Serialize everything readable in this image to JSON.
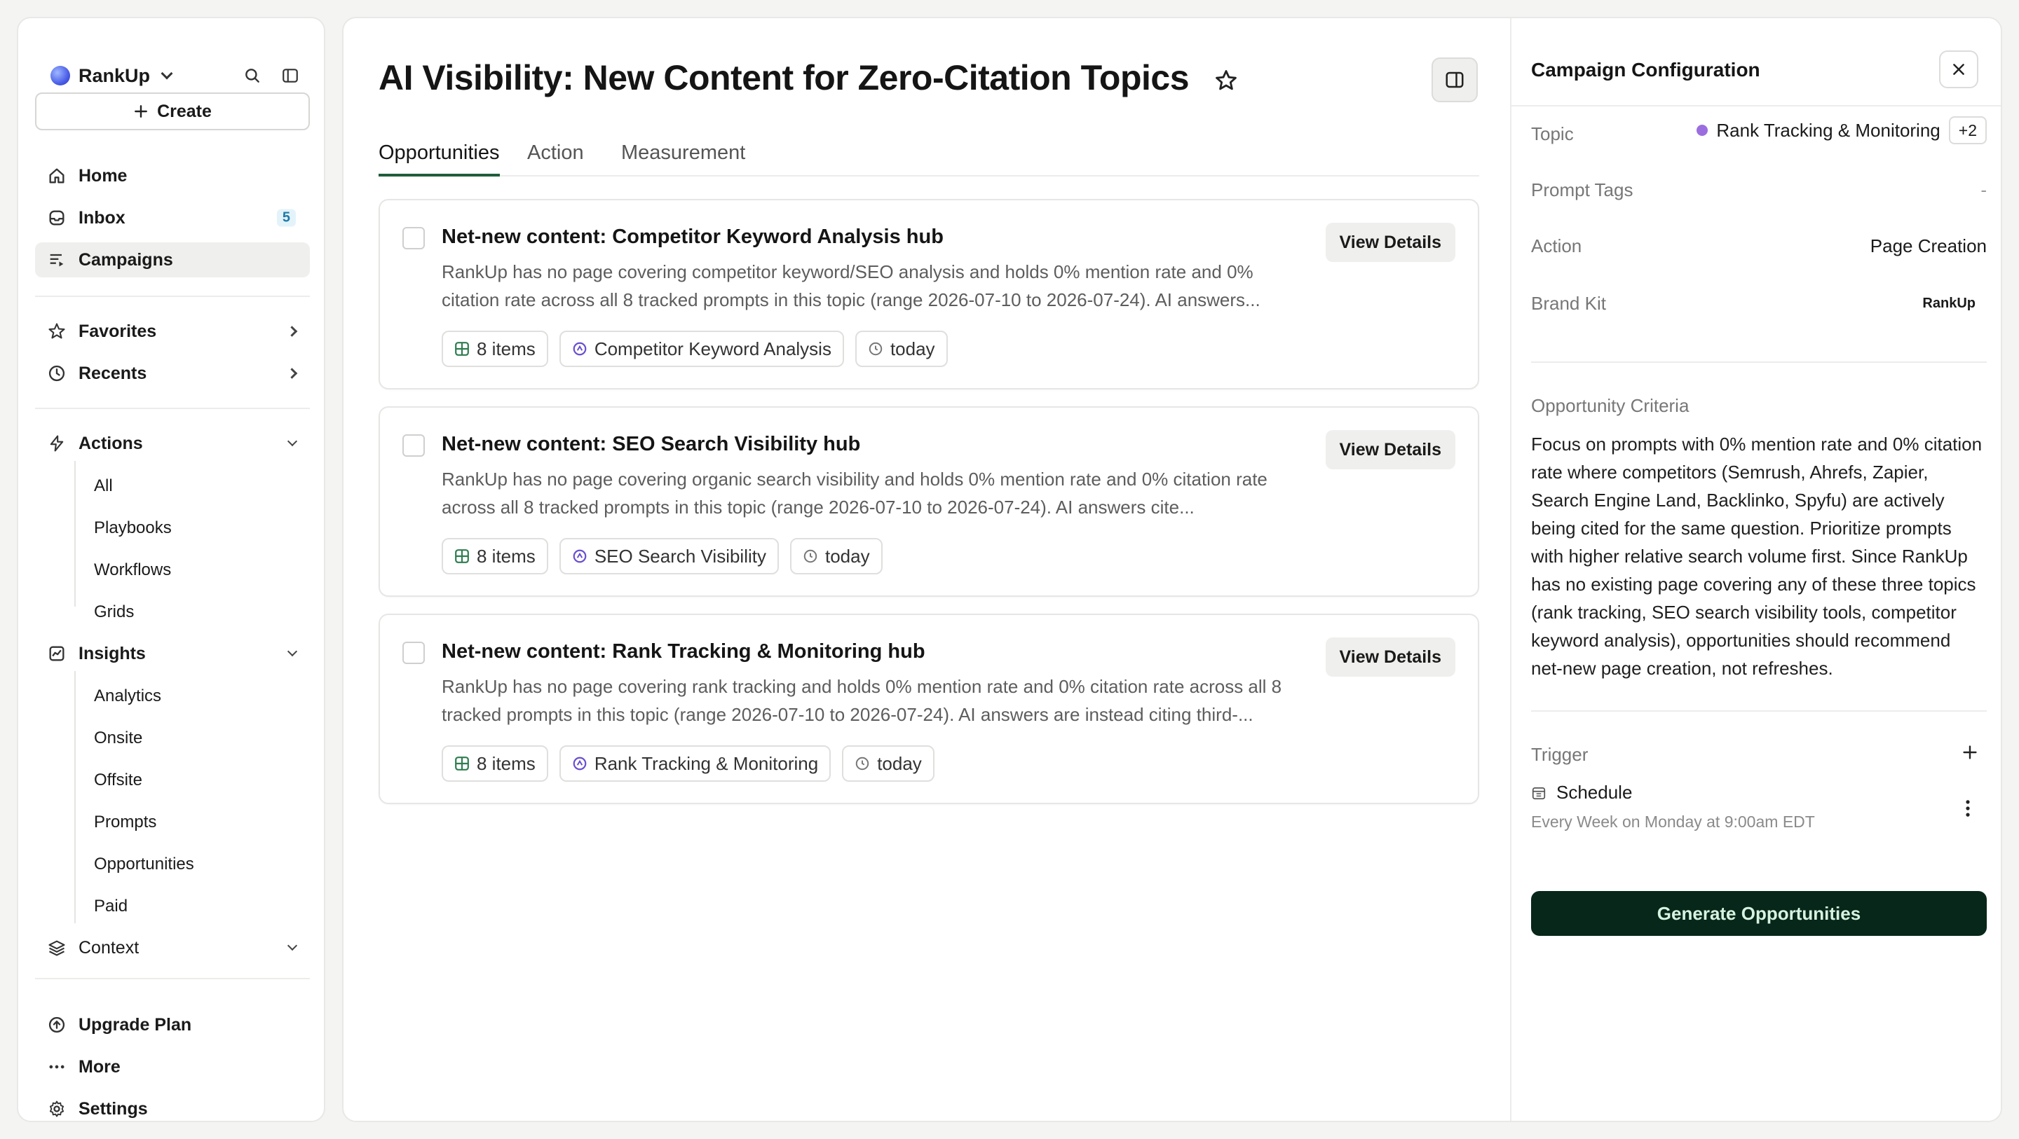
{
  "sidebar": {
    "brand": "RankUp",
    "create_label": "Create",
    "nav": {
      "home": "Home",
      "inbox": "Inbox",
      "inbox_count": "5",
      "campaigns": "Campaigns",
      "favorites": "Favorites",
      "recents": "Recents",
      "actions": "Actions",
      "insights": "Insights",
      "context": "Context",
      "upgrade": "Upgrade Plan",
      "more": "More",
      "settings": "Settings"
    },
    "actions_items": [
      "All",
      "Playbooks",
      "Workflows",
      "Grids"
    ],
    "insights_items": [
      "Analytics",
      "Onsite",
      "Offsite",
      "Prompts",
      "Opportunities",
      "Paid"
    ]
  },
  "main": {
    "title": "AI Visibility: New Content for Zero-Citation Topics",
    "tabs": [
      "Opportunities",
      "Action",
      "Measurement"
    ],
    "active_tab": "Opportunities",
    "cards": [
      {
        "title": "Net-new content: Competitor Keyword Analysis hub",
        "description": "RankUp has no page covering competitor keyword/SEO analysis and holds 0% mention rate and 0% citation rate across all 8 tracked prompts in this topic (range 2026-07-10 to 2026-07-24). AI answers...",
        "button": "View Details",
        "items": "8 items",
        "topic": "Competitor Keyword Analysis",
        "time": "today"
      },
      {
        "title": "Net-new content: SEO Search Visibility hub",
        "description": "RankUp has no page covering organic search visibility and holds 0% mention rate and 0% citation rate across all 8 tracked prompts in this topic (range 2026-07-10 to 2026-07-24). AI answers cite...",
        "button": "View Details",
        "items": "8 items",
        "topic": "SEO Search Visibility",
        "time": "today"
      },
      {
        "title": "Net-new content: Rank Tracking & Monitoring hub",
        "description": "RankUp has no page covering rank tracking and holds 0% mention rate and 0% citation rate across all 8 tracked prompts in this topic (range 2026-07-10 to 2026-07-24). AI answers are instead citing third-...",
        "button": "View Details",
        "items": "8 items",
        "topic": "Rank Tracking & Monitoring",
        "time": "today"
      }
    ]
  },
  "panel": {
    "title": "Campaign Configuration",
    "topic_label": "Topic",
    "topic_value": "Rank Tracking & Monitoring",
    "topic_extra": "+2",
    "prompt_tags_label": "Prompt Tags",
    "prompt_tags_value": "-",
    "action_label": "Action",
    "action_value": "Page Creation",
    "brand_kit_label": "Brand Kit",
    "brand_kit_value": "RankUp",
    "criteria_label": "Opportunity Criteria",
    "criteria_text": "Focus on prompts with 0% mention rate and 0% citation rate where competitors (Semrush, Ahrefs, Zapier, Search Engine Land, Backlinko, Spyfu) are actively being cited for the same question. Prioritize prompts with higher relative search volume first. Since RankUp has no existing page covering any of these three topics (rank tracking, SEO search visibility tools, competitor keyword analysis), opportunities should recommend net-new page creation, not refreshes.",
    "trigger_label": "Trigger",
    "schedule_label": "Schedule",
    "schedule_detail": "Every Week on Monday at 9:00am EDT",
    "generate_label": "Generate Opportunities"
  },
  "colors": {
    "accent_dark_green": "#06271a",
    "tab_underline": "#1f5e3b",
    "topic_dot": "#9b6ee0",
    "badge_blue": "#1e7aa8"
  }
}
